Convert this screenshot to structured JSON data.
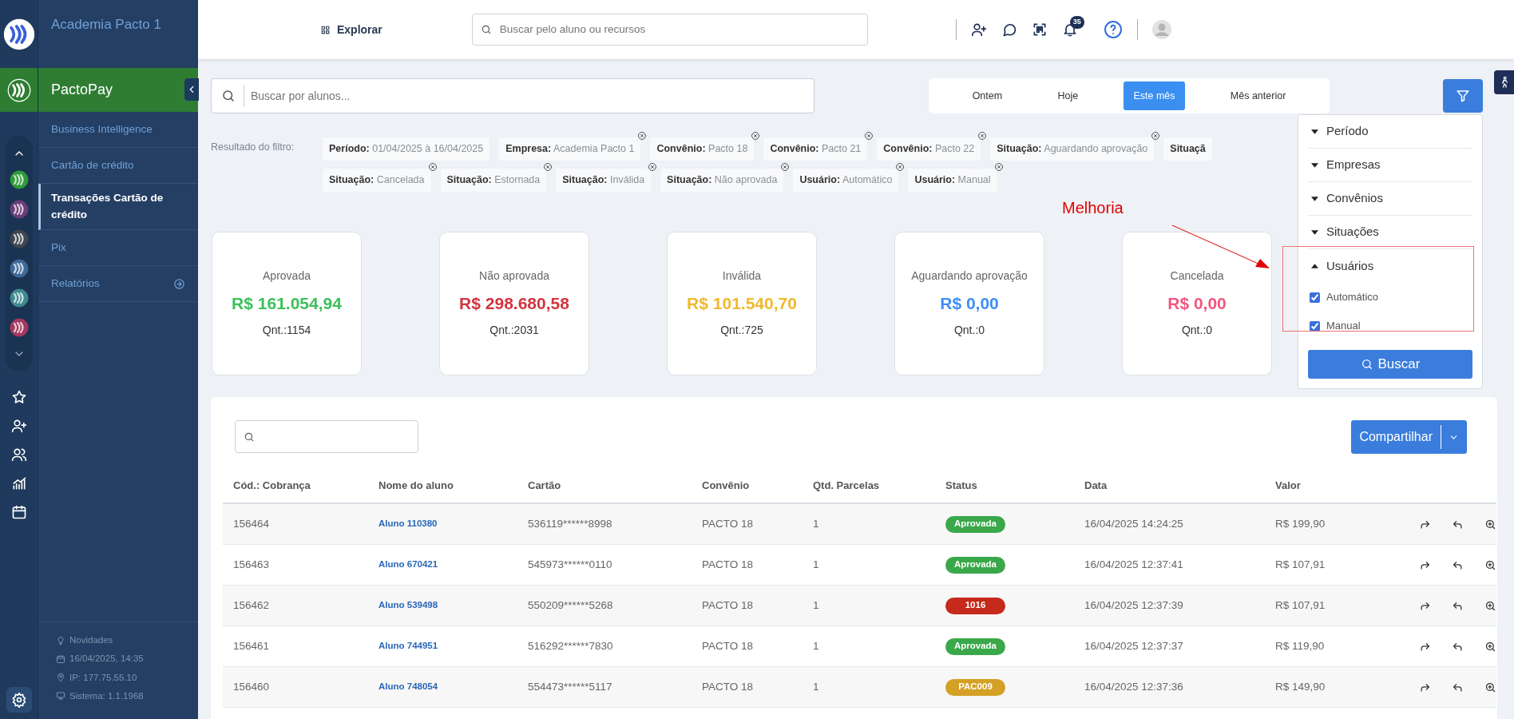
{
  "rail": {
    "apps": [
      {
        "color": "#2e9a3a"
      },
      {
        "color": "#6b3d7a"
      },
      {
        "color": "#3f4650"
      },
      {
        "color": "#3e6a9a"
      },
      {
        "color": "#3f8a8f"
      },
      {
        "color": "#a5385f"
      }
    ]
  },
  "sidebar": {
    "brand": "Academia Pacto 1",
    "module": "PactoPay",
    "items": [
      {
        "label": "Business Intelligence",
        "selected": false
      },
      {
        "label": "Cartão de crédito",
        "selected": false
      },
      {
        "label": "Transações Cartão de crédito",
        "selected": true
      },
      {
        "label": "Pix",
        "selected": false
      },
      {
        "label": "Relatórios",
        "selected": false,
        "kind": "submenu"
      }
    ],
    "footer": [
      {
        "kind": "news",
        "text": "Novidades"
      },
      {
        "kind": "date",
        "text": "16/04/2025, 14:35"
      },
      {
        "kind": "ip",
        "text": "IP: 177.75.55.10"
      },
      {
        "kind": "system",
        "text": "Sistema: 1.1.1968"
      }
    ]
  },
  "topbar": {
    "explore": "Explorar",
    "search": {
      "placeholder": "Buscar pelo aluno ou recursos"
    },
    "notifications": "35"
  },
  "search": {
    "placeholder": "Buscar por alunos..."
  },
  "periods": [
    {
      "label": "Ontem",
      "selected": false
    },
    {
      "label": "Hoje",
      "selected": false
    },
    {
      "label": "Este mês",
      "selected": true
    },
    {
      "label": "Mês anterior",
      "selected": false
    }
  ],
  "filter_result": {
    "label": "Resultado do filtro:",
    "chip_rows": [
      [
        {
          "key": "Período:",
          "value": "01/04/2025 à 16/04/2025",
          "removable": false
        },
        {
          "key": "Empresa:",
          "value": "Academia Pacto 1",
          "removable": true
        },
        {
          "key": "Convênio:",
          "value": "Pacto 18",
          "removable": true
        },
        {
          "key": "Convênio:",
          "value": "Pacto 21",
          "removable": true
        },
        {
          "key": "Convênio:",
          "value": "Pacto 22",
          "removable": true
        },
        {
          "key": "Situação:",
          "value": "Aguardando aprovação",
          "removable": true
        },
        {
          "key": "Situaçã",
          "removable": false
        }
      ],
      [
        {
          "key": "Situação:",
          "value": "Cancelada",
          "removable": true
        },
        {
          "key": "Situação:",
          "value": "Estornada",
          "removable": true
        },
        {
          "key": "Situação:",
          "value": "Inválida",
          "removable": true
        },
        {
          "key": "Situação:",
          "value": "Não aprovada",
          "removable": true
        },
        {
          "key": "Usuário:",
          "value": "Automático",
          "removable": true
        },
        {
          "key": "Usuário:",
          "value": "Manual",
          "removable": true
        }
      ]
    ]
  },
  "summary_cards": [
    {
      "title": "Aprovada",
      "amount": "R$ 161.054,94",
      "count": "Qnt.:1154",
      "color": "#3cc05a"
    },
    {
      "title": "Não aprovada",
      "amount": "R$ 298.680,58",
      "count": "Qnt.:2031",
      "color": "#d4343f"
    },
    {
      "title": "Inválida",
      "amount": "R$ 101.540,70",
      "count": "Qnt.:725",
      "color": "#f0b92e"
    },
    {
      "title": "Aguardando aprovação",
      "amount": "R$ 0,00",
      "count": "Qnt.:0",
      "color": "#3f8ef5"
    },
    {
      "title": "Cancelada",
      "amount": "R$ 0,00",
      "count": "Qnt.:0",
      "color": "#f2577f"
    }
  ],
  "filter_panel": {
    "sections": [
      {
        "label": "Período",
        "expanded": false
      },
      {
        "label": "Empresas",
        "expanded": false
      },
      {
        "label": "Convênios",
        "expanded": false
      },
      {
        "label": "Situações",
        "expanded": false
      },
      {
        "label": "Usuários",
        "expanded": true,
        "highlighted": true,
        "options": [
          {
            "label": "Automático",
            "checked": true
          },
          {
            "label": "Manual",
            "checked": true
          }
        ]
      }
    ],
    "button": "Buscar"
  },
  "annotation": {
    "text": "Melhoria"
  },
  "table": {
    "share_button": "Compartilhar",
    "columns": [
      "Cód.: Cobrança",
      "Nome do aluno",
      "Cartão",
      "Convênio",
      "Qtd. Parcelas",
      "Status",
      "Data",
      "Valor"
    ],
    "rows": [
      {
        "code": "156464",
        "student": "Aluno 110380",
        "card": "536119******8998",
        "agreement": "PACTO 18",
        "installments": "1",
        "status": {
          "label": "Aprovada",
          "color": "#3aa84a"
        },
        "date": "16/04/2025 14:24:25",
        "value": "R$ 199,90"
      },
      {
        "code": "156463",
        "student": "Aluno 670421",
        "card": "545973******0110",
        "agreement": "PACTO 18",
        "installments": "1",
        "status": {
          "label": "Aprovada",
          "color": "#3aa84a"
        },
        "date": "16/04/2025 12:37:41",
        "value": "R$ 107,91"
      },
      {
        "code": "156462",
        "student": "Aluno 539498",
        "card": "550209******5268",
        "agreement": "PACTO 18",
        "installments": "1",
        "status": {
          "label": "1016",
          "color": "#c62a1a"
        },
        "date": "16/04/2025 12:37:39",
        "value": "R$ 107,91"
      },
      {
        "code": "156461",
        "student": "Aluno 744951",
        "card": "516292******7830",
        "agreement": "PACTO 18",
        "installments": "1",
        "status": {
          "label": "Aprovada",
          "color": "#3aa84a"
        },
        "date": "16/04/2025 12:37:37",
        "value": "R$ 119,90"
      },
      {
        "code": "156460",
        "student": "Aluno 748054",
        "card": "554473******5117",
        "agreement": "PACTO 18",
        "installments": "1",
        "status": {
          "label": "PAC009",
          "color": "#d4a025"
        },
        "date": "16/04/2025 12:37:36",
        "value": "R$ 149,90"
      }
    ]
  }
}
